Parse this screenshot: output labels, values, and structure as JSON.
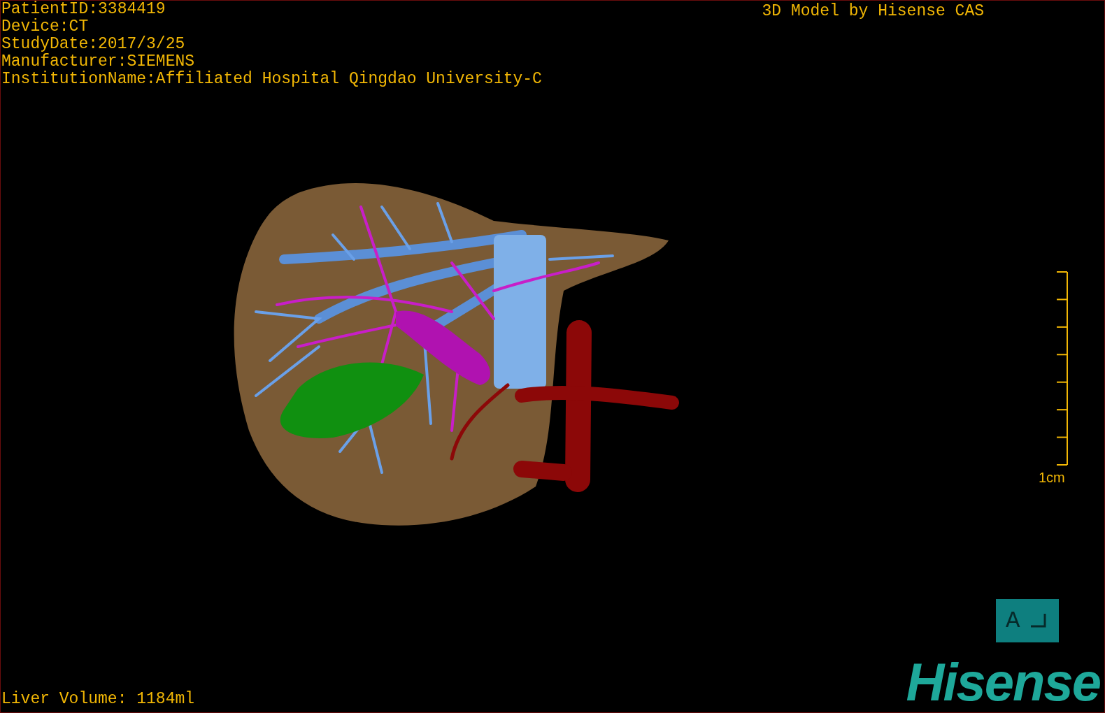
{
  "patient_info": [
    "PatientID:3384419",
    "Device:CT",
    "StudyDate:2017/3/25",
    "Manufacturer:SIEMENS",
    "InstitutionName:Affiliated Hospital Qingdao University-C"
  ],
  "title": "3D Model by Hisense CAS",
  "scale_bar": {
    "label": "1cm"
  },
  "orientation": {
    "label": "A"
  },
  "liver_volume": "Liver Volume: 1184ml",
  "logo": "Hisense"
}
